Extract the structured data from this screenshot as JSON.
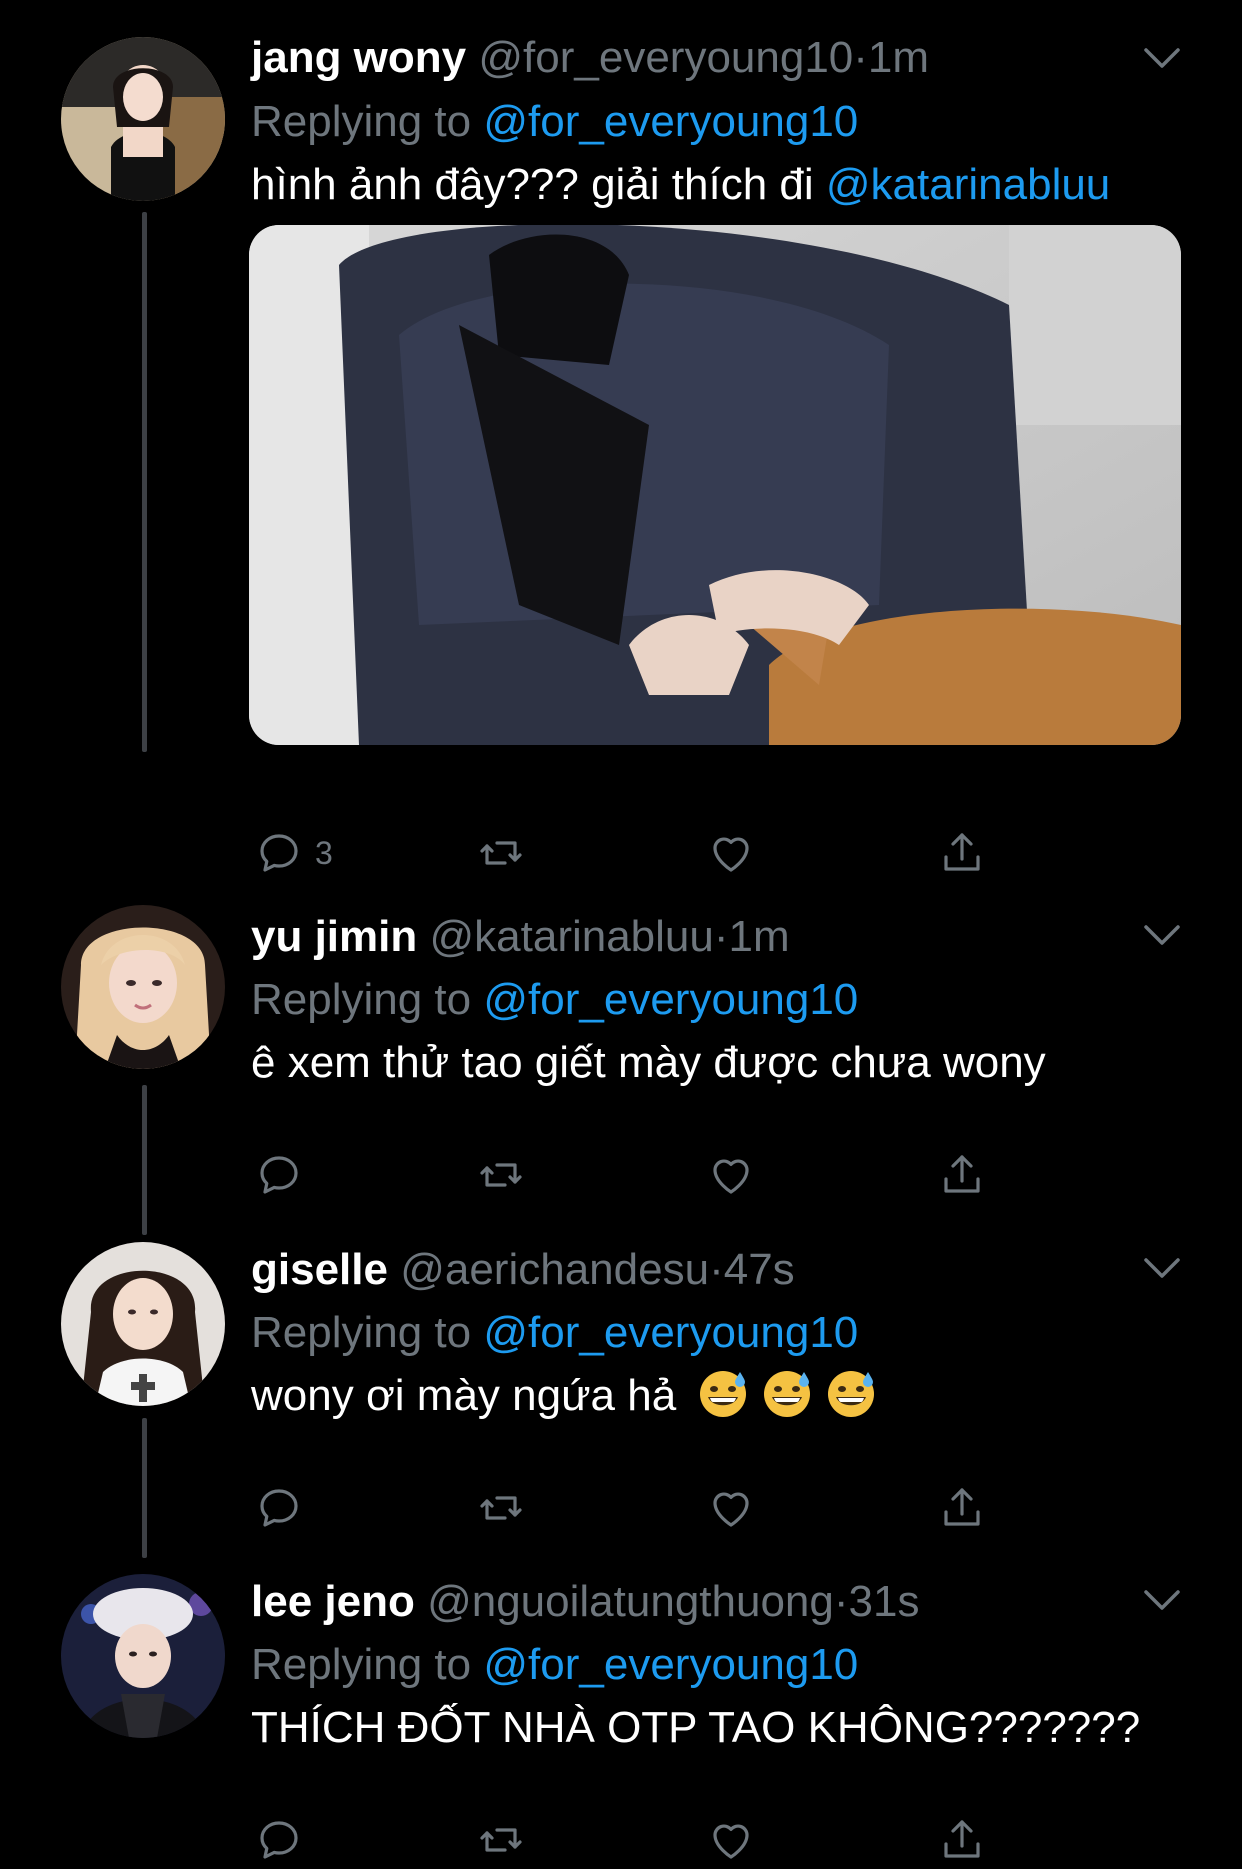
{
  "colors": {
    "background": "#000000",
    "muted": "#6e767d",
    "link": "#1d9bf0",
    "thread_line": "#3d4045"
  },
  "tweets": [
    {
      "name": "jang wony",
      "handle": "@for_everyoung10",
      "separator": "·",
      "time": "1m",
      "replying_prefix": "Replying to",
      "replying_to": "@for_everyoung10",
      "text": "hình ảnh đây??? giải thích đi",
      "text_mention": "@katarinabluu",
      "reply_count": "3",
      "has_media": true
    },
    {
      "name": "yu jimin",
      "handle": "@katarinabluu",
      "separator": "·",
      "time": "1m",
      "replying_prefix": "Replying to",
      "replying_to": "@for_everyoung10",
      "text": "ê xem thử tao giết mày được chưa wony",
      "reply_count": ""
    },
    {
      "name": "giselle",
      "handle": "@aerichandesu",
      "separator": "·",
      "time": "47s",
      "replying_prefix": "Replying to",
      "replying_to": "@for_everyoung10",
      "text": "wony ơi mày ngứa hả",
      "emojis": [
        "grinning-face-with-sweat",
        "grinning-face-with-sweat",
        "grinning-face-with-sweat"
      ],
      "reply_count": ""
    },
    {
      "name": "lee jeno",
      "handle": "@nguoilatungthuong",
      "separator": "·",
      "time": "31s",
      "replying_prefix": "Replying to",
      "replying_to": "@for_everyoung10",
      "text": "THÍCH ĐỐT NHÀ OTP TAO KHÔNG???????",
      "reply_count": ""
    }
  ],
  "icons": {
    "reply": "reply-icon",
    "retweet": "retweet-icon",
    "like": "heart-icon",
    "share": "share-icon",
    "more": "chevron-down-icon"
  }
}
